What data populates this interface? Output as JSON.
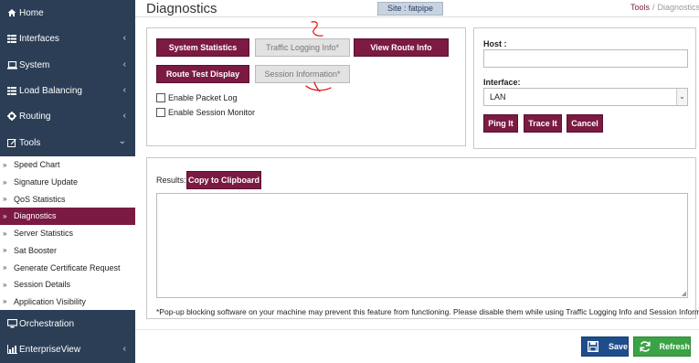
{
  "sidebar": {
    "items": [
      {
        "label": "Home",
        "icon": "home-icon",
        "has_chevron": false
      },
      {
        "label": "Interfaces",
        "icon": "grid-icon",
        "has_chevron": true
      },
      {
        "label": "System",
        "icon": "laptop-icon",
        "has_chevron": true
      },
      {
        "label": "Load Balancing",
        "icon": "grid-icon",
        "has_chevron": true
      },
      {
        "label": "Routing",
        "icon": "gear-icon",
        "has_chevron": true
      },
      {
        "label": "Tools",
        "icon": "edit-icon",
        "has_chevron": true,
        "expanded": true
      },
      {
        "label": "Orchestration",
        "icon": "monitor-icon",
        "has_chevron": false
      },
      {
        "label": "EnterpriseView",
        "icon": "chart-icon",
        "has_chevron": true
      }
    ],
    "tools_subitems": [
      {
        "label": "Speed Chart"
      },
      {
        "label": "Signature Update"
      },
      {
        "label": "QoS Statistics"
      },
      {
        "label": "Diagnostics",
        "active": true
      },
      {
        "label": "Server Statistics"
      },
      {
        "label": "Sat Booster"
      },
      {
        "label": "Generate Certificate Request"
      },
      {
        "label": "Session Details"
      },
      {
        "label": "Application Visibility"
      }
    ]
  },
  "header": {
    "title": "Diagnostics",
    "site_badge": "Site : fatpipe",
    "breadcrumb": {
      "parent": "Tools",
      "current": "Diagnostics"
    }
  },
  "tools": {
    "system_statistics": "System Statistics",
    "traffic_logging_info": "Traffic Logging Info*",
    "view_route_info": "View Route Info",
    "route_test_display": "Route Test Display",
    "session_information": "Session Information*",
    "enable_packet_log": "Enable Packet Log",
    "enable_session_monitor": "Enable Session Monitor"
  },
  "host_panel": {
    "host_label": "Host :",
    "host_value": "",
    "interface_label": "Interface:",
    "interface_selected": "LAN",
    "ping_label": "Ping It",
    "trace_label": "Trace It",
    "cancel_label": "Cancel"
  },
  "results": {
    "label": "Results:",
    "copy_label": "Copy to Clipboard",
    "value": "",
    "note": "*Pop-up blocking software on your machine may prevent this feature from functioning. Please disable them while using Traffic Logging Info and Session Information."
  },
  "actions": {
    "save_label": "Save",
    "refresh_label": "Refresh"
  },
  "colors": {
    "sidebar": "#2c3e56",
    "accent": "#7b1a42",
    "save": "#1e4d8c",
    "refresh": "#3aa346",
    "annotation": "#e01010"
  }
}
